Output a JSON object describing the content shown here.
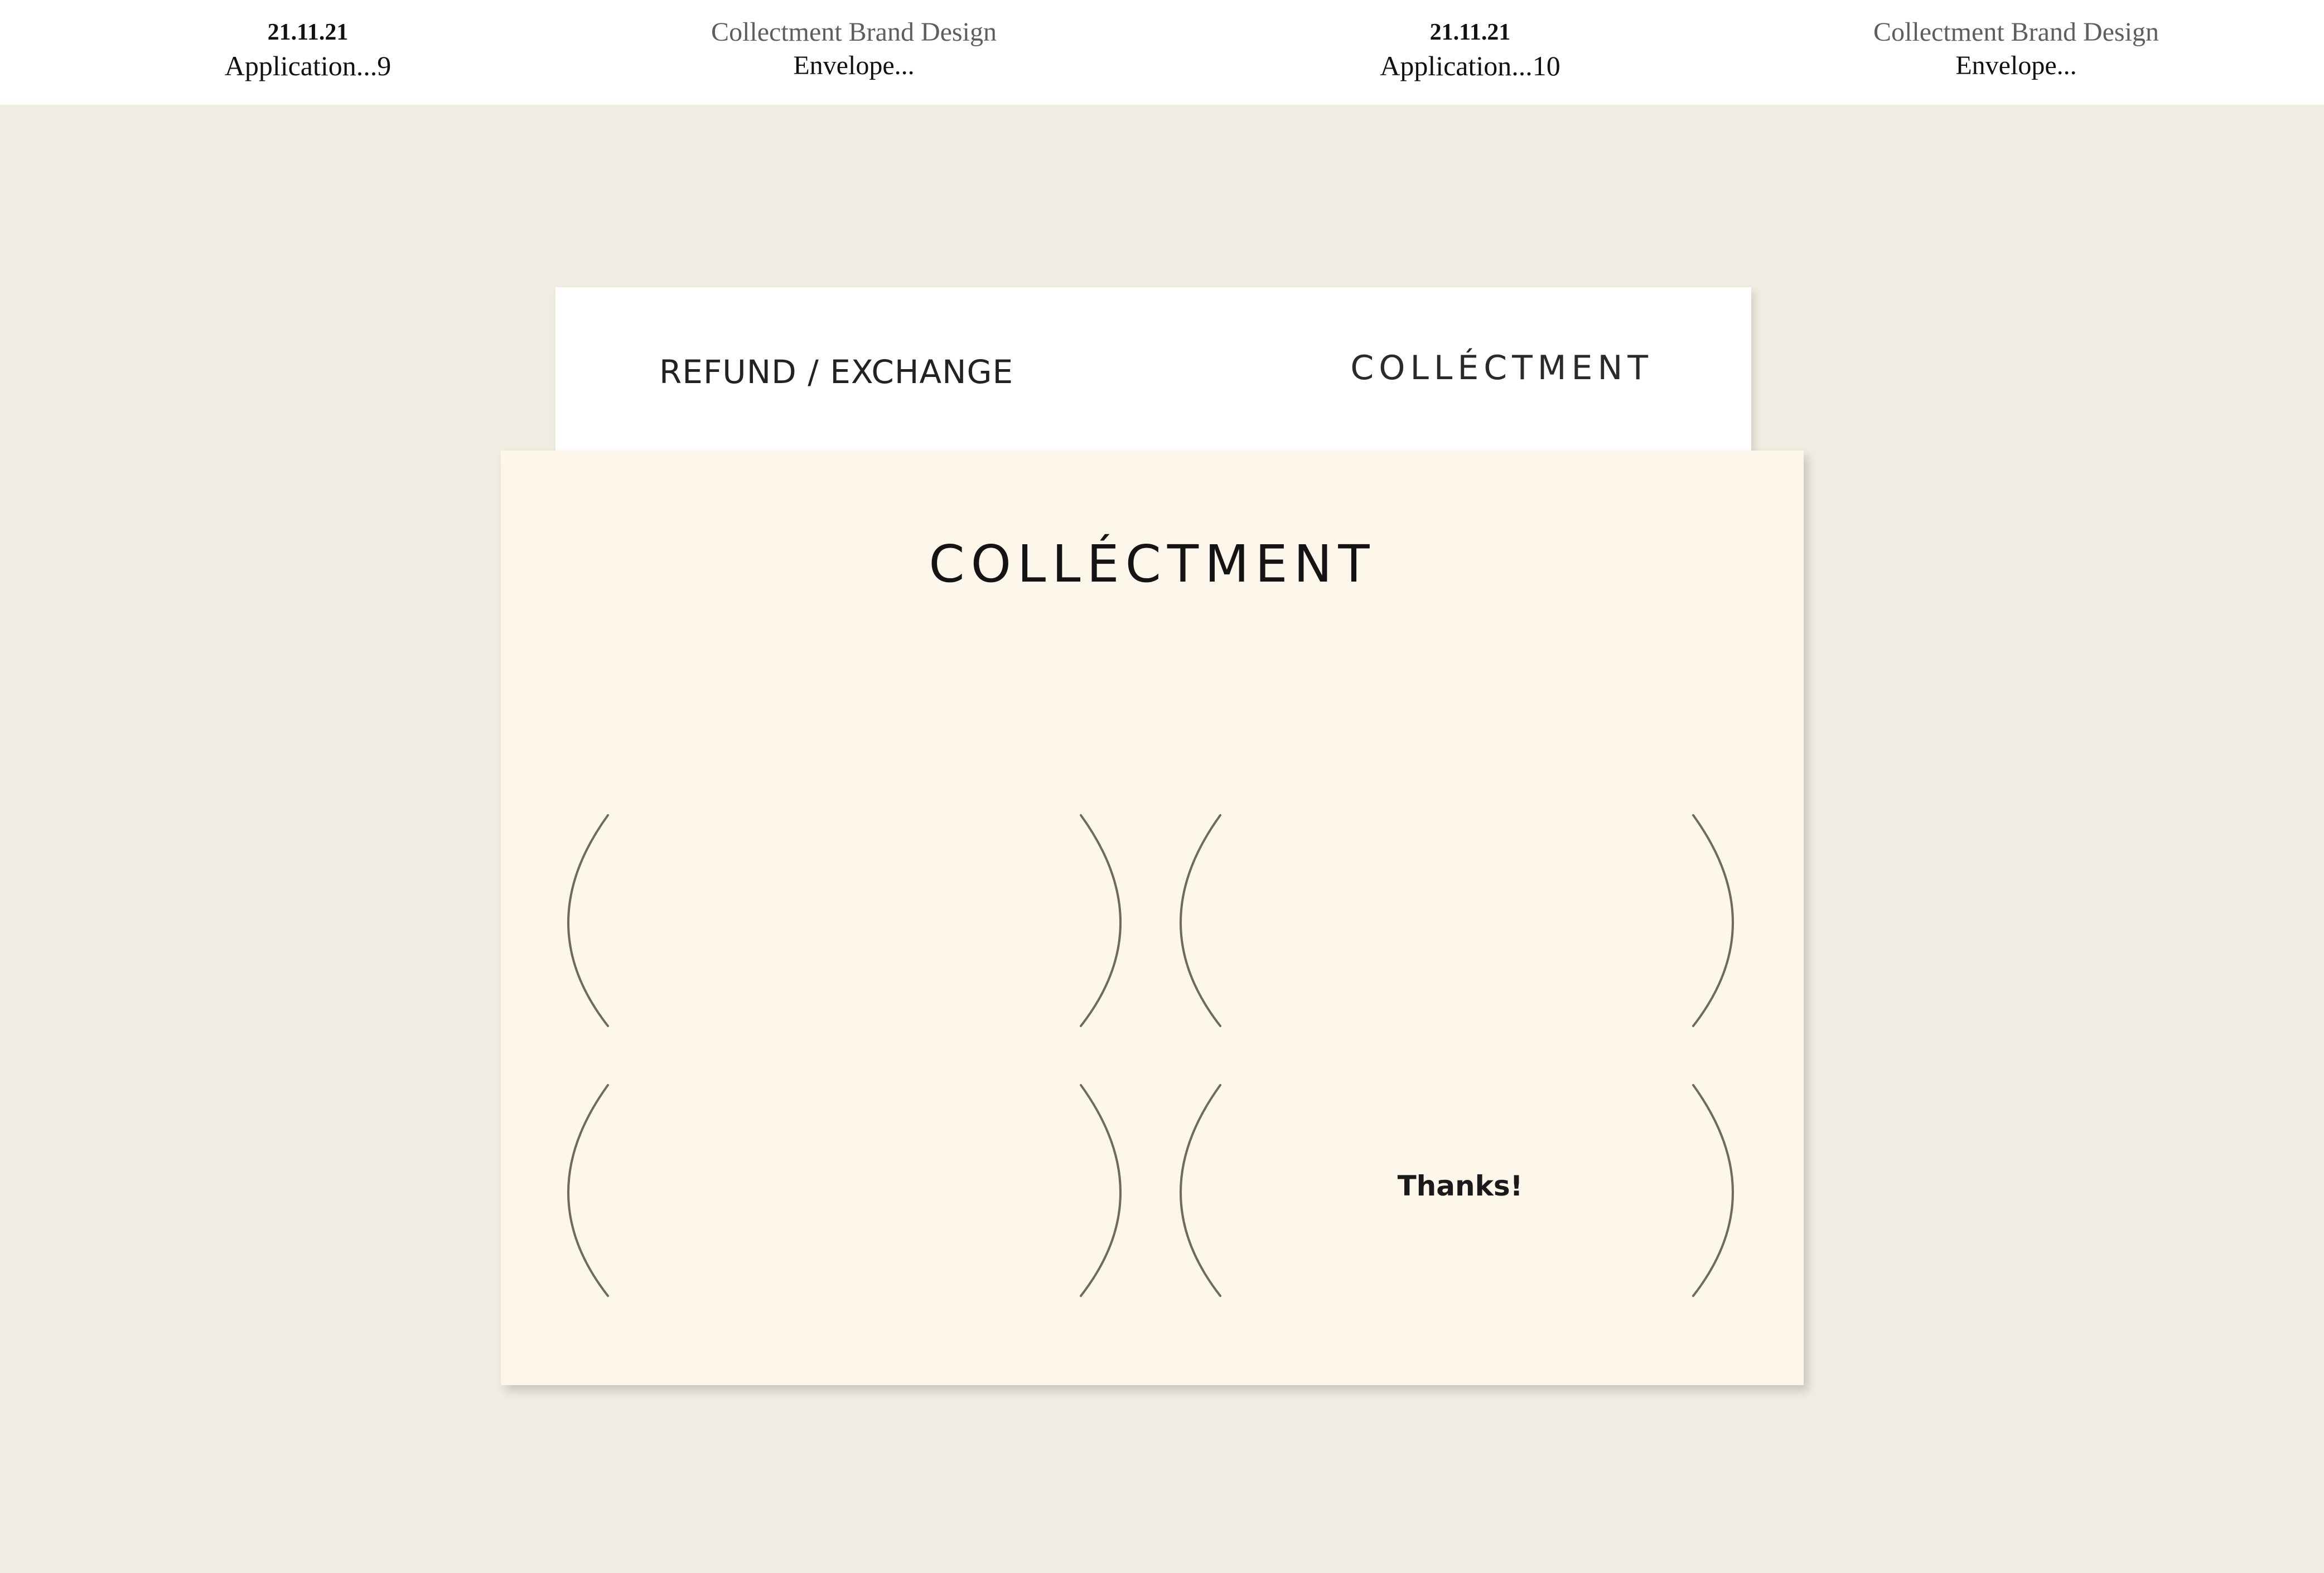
{
  "header": {
    "columns": [
      {
        "line1": "21.11.21",
        "line2": "Application...9"
      },
      {
        "line1": "Collectment Brand Design",
        "line2": "Envelope..."
      },
      {
        "line1": "21.11.21",
        "line2": "Application...10"
      },
      {
        "line1": "Collectment Brand Design",
        "line2": "Envelope..."
      }
    ]
  },
  "insert_card": {
    "title": "REFUND / EXCHANGE",
    "logo": "COLLÉCTMENT"
  },
  "envelope": {
    "logo": "COLLÉCTMENT",
    "slots": [
      {
        "text": ""
      },
      {
        "text": ""
      },
      {
        "text": ""
      },
      {
        "text": "Thanks!"
      }
    ]
  },
  "colors": {
    "page_background": "#f0ece1",
    "header_background": "#ffffff",
    "envelope_background": "#fdf7eb",
    "bracket_stroke": "#6f6a5c"
  }
}
